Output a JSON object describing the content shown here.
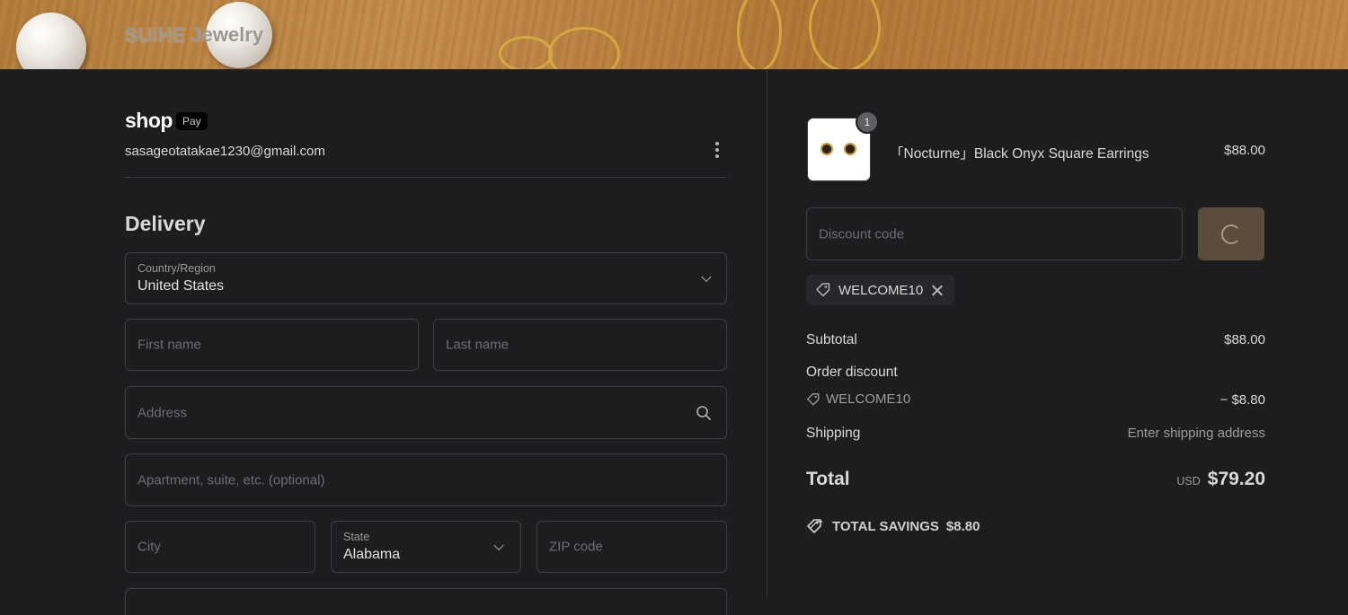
{
  "header": {
    "brand": "SUIHE Jewelry"
  },
  "account": {
    "shop_word": "shop",
    "pay_word": "Pay",
    "email": "sasageotatakae1230@gmail.com"
  },
  "delivery": {
    "title": "Delivery",
    "country": {
      "label": "Country/Region",
      "value": "United States"
    },
    "first_name": {
      "placeholder": "First name"
    },
    "last_name": {
      "placeholder": "Last name"
    },
    "address": {
      "placeholder": "Address"
    },
    "apartment": {
      "placeholder": "Apartment, suite, etc. (optional)"
    },
    "city": {
      "placeholder": "City"
    },
    "state": {
      "label": "State",
      "value": "Alabama"
    },
    "zip": {
      "placeholder": "ZIP code"
    }
  },
  "summary": {
    "item": {
      "quantity": "1",
      "name": "「Nocturne」Black Onyx Square Earrings",
      "price": "$88.00"
    },
    "discount_placeholder": "Discount code",
    "applied_code": "WELCOME10",
    "subtotal_label": "Subtotal",
    "subtotal_value": "$88.00",
    "order_discount_label": "Order discount",
    "discount_code": "WELCOME10",
    "discount_value": "− $8.80",
    "shipping_label": "Shipping",
    "shipping_value": "Enter shipping address",
    "total_label": "Total",
    "total_currency": "USD",
    "total_value": "$79.20",
    "savings_label": "TOTAL SAVINGS",
    "savings_value": "$8.80"
  },
  "colors": {
    "background": "#1c1d1f",
    "apply_button": "#5b4d3b",
    "border": "#3d3e42"
  }
}
